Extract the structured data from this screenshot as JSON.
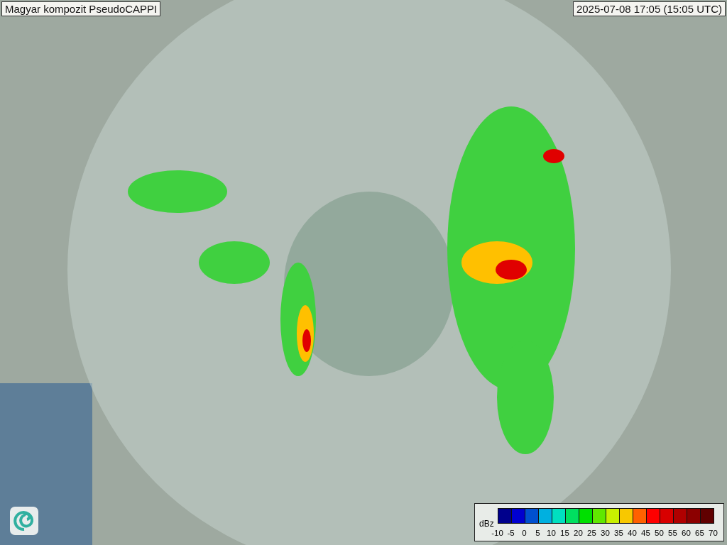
{
  "title": "Magyar kompozit  PseudoCAPPI",
  "timestamp": "2025-07-08 17:05 (15:05 UTC)",
  "legend": {
    "unit": "dBz",
    "bins": [
      {
        "color": "#00008c"
      },
      {
        "color": "#0000d0"
      },
      {
        "color": "#0050d0"
      },
      {
        "color": "#00b0e0"
      },
      {
        "color": "#00e0c0"
      },
      {
        "color": "#00e060"
      },
      {
        "color": "#00e000"
      },
      {
        "color": "#60e800"
      },
      {
        "color": "#c8f000"
      },
      {
        "color": "#f8c800"
      },
      {
        "color": "#ff6000"
      },
      {
        "color": "#ff0000"
      },
      {
        "color": "#d80000"
      },
      {
        "color": "#b00000"
      },
      {
        "color": "#8c0000"
      },
      {
        "color": "#600000"
      }
    ],
    "ticks": [
      "-10",
      "-5",
      "0",
      "5",
      "10",
      "15",
      "20",
      "25",
      "30",
      "35",
      "40",
      "45",
      "50",
      "55",
      "60",
      "65",
      "70"
    ]
  }
}
